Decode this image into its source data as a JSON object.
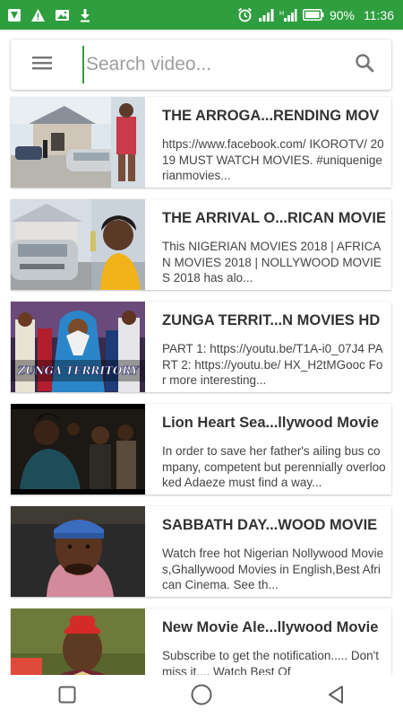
{
  "status_bar": {
    "battery": "90%",
    "time": "11:36",
    "colors": {
      "background": "#2e9e3f"
    }
  },
  "search": {
    "placeholder": "Search video..."
  },
  "videos": [
    {
      "title": "THE ARROGA...RENDING MOV",
      "description": "https://www.facebook.com/ IKOROTV/ 2019 MUST WATCH MOVIES. #uniquenigerianmovies..."
    },
    {
      "title": "THE ARRIVAL O...RICAN MOVIE",
      "description": "This NIGERIAN MOVIES 2018 | AFRICAN MOVIES 2018 | NOLLYWOOD MOVIES 2018 has alo..."
    },
    {
      "title": "ZUNGA TERRIT...N MOVIES HD",
      "description": "PART 1: https://youtu.be/T1A-i0_07J4 PART 2: https://youtu.be/ HX_H2tMGooc For more interesting...",
      "thumb_text": "ZUNGA TERRITORY"
    },
    {
      "title": "Lion Heart Sea...llywood Movie",
      "description": "In order to save her father's ailing bus company, competent but perennially overlooked Adaeze must find a way..."
    },
    {
      "title": "SABBATH DAY...WOOD MOVIE",
      "description": "Watch free hot Nigerian Nollywood Movies,Ghallywood Movies in English,Best African Cinema. See th..."
    },
    {
      "title": "New Movie Ale...llywood Movie",
      "description": "Subscribe to get the notification..... Don't miss it.... Watch Best Of"
    }
  ]
}
